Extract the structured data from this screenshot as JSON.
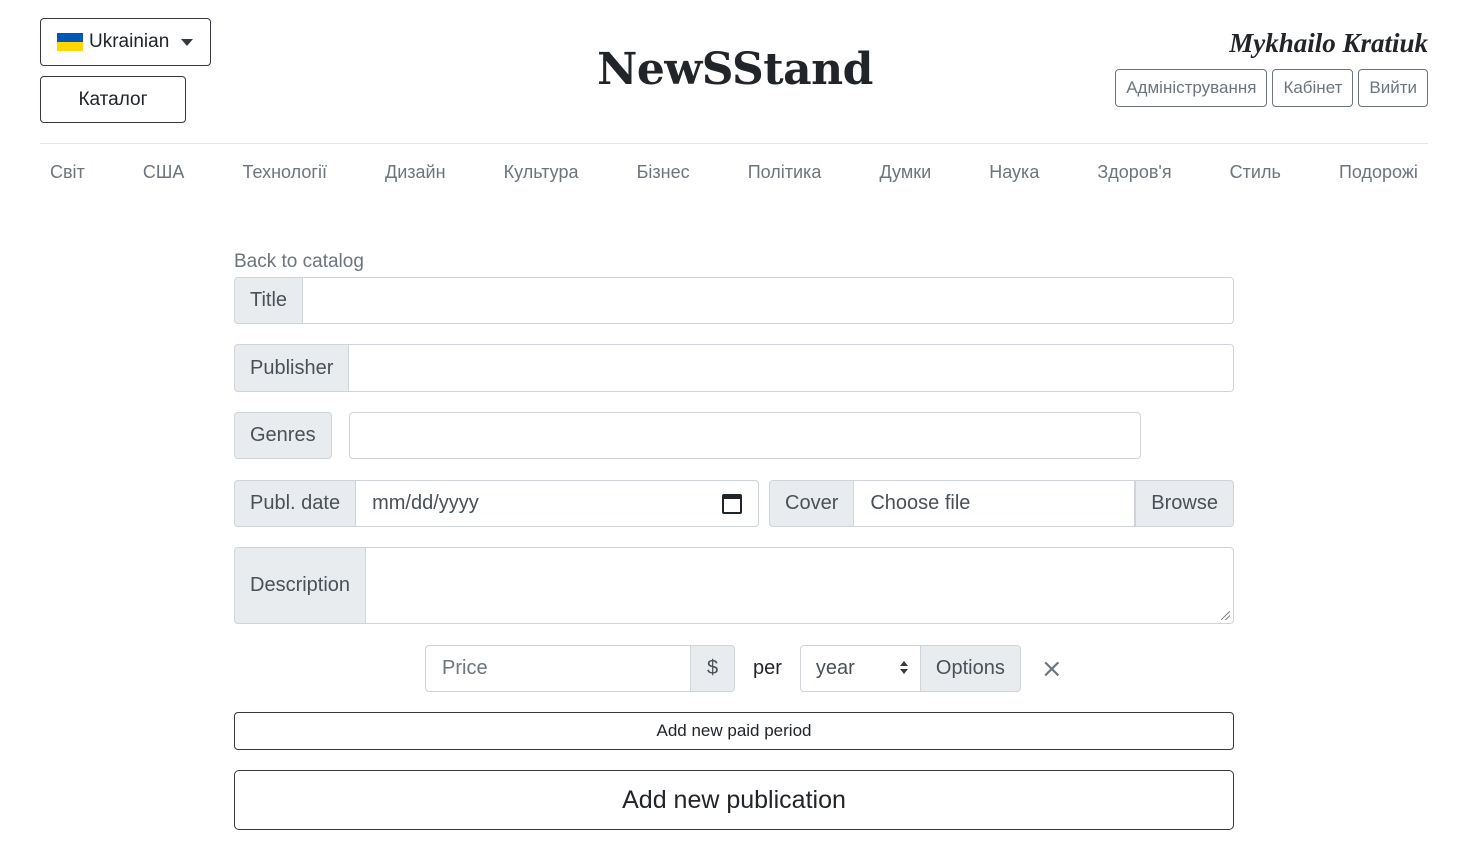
{
  "header": {
    "language": "Ukrainian",
    "catalog_button": "Каталог",
    "brand": "NewSStand",
    "user_name": "Mykhailo Kratiuk",
    "admin_button": "Адміністрування",
    "cabinet_button": "Кабінет",
    "logout_button": "Вийти",
    "flag_colors": {
      "top": "#0057b7",
      "bottom": "#ffd700"
    }
  },
  "nav": {
    "items": [
      "Світ",
      "США",
      "Технології",
      "Дизайн",
      "Культура",
      "Бізнес",
      "Політика",
      "Думки",
      "Наука",
      "Здоров'я",
      "Стиль",
      "Подорожі"
    ]
  },
  "form": {
    "back_link": "Back to catalog",
    "title_label": "Title",
    "title_value": "",
    "publisher_label": "Publisher",
    "publisher_value": "",
    "genres_label": "Genres",
    "genres_value": "",
    "publ_date_label": "Publ. date",
    "publ_date_value": "mm/dd/yyyy",
    "cover_label": "Cover",
    "cover_value": "Choose file",
    "cover_browse": "Browse",
    "description_label": "Description",
    "description_value": "",
    "price_placeholder": "Price",
    "currency": "$",
    "per": "per",
    "period_selected": "year",
    "options_label": "Options",
    "remove_icon": "×",
    "add_period_button": "Add new paid period",
    "add_publication_button": "Add new publication"
  }
}
